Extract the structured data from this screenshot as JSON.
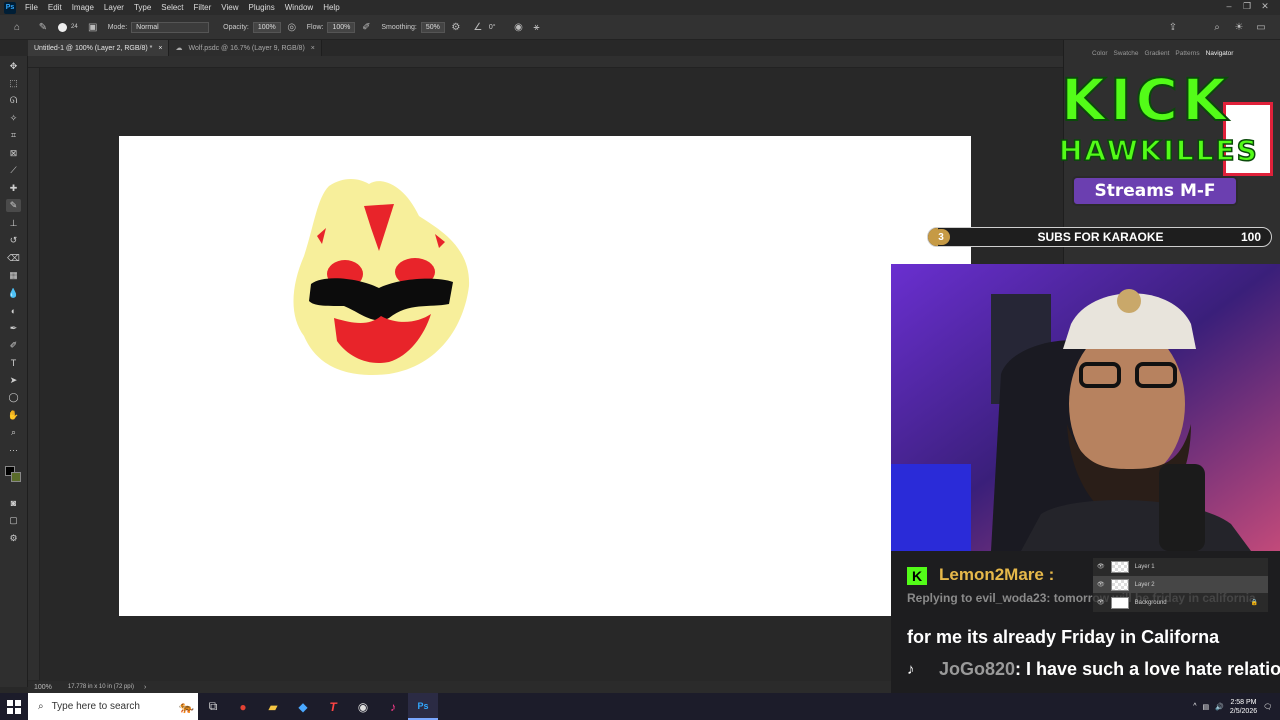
{
  "menubar": {
    "app_logo": "Ps",
    "items": [
      "File",
      "Edit",
      "Image",
      "Layer",
      "Type",
      "Select",
      "Filter",
      "View",
      "Plugins",
      "Window",
      "Help"
    ]
  },
  "options": {
    "brush_size": "24",
    "mode_label": "Mode:",
    "mode_value": "Normal",
    "opacity_label": "Opacity:",
    "opacity_value": "100%",
    "flow_label": "Flow:",
    "flow_value": "100%",
    "smoothing_label": "Smoothing:",
    "smoothing_value": "50%",
    "angle_value": "0°"
  },
  "tabs": [
    {
      "label": "Untitled-1 @ 100% (Layer 2, RGB/8) *"
    },
    {
      "label": "Wolf.psdc @ 16.7% (Layer 9, RGB/8)"
    }
  ],
  "status": {
    "zoom": "100%",
    "doc_size": "17.778 in x 10 in (72 ppi)"
  },
  "right_panel": {
    "tabs": [
      "Color",
      "Swatche",
      "Gradient",
      "Patterns",
      "Navigator"
    ],
    "active_tab": "Navigator"
  },
  "overlay": {
    "logo_line1": "KICK",
    "logo_line2": "HAWKILLES",
    "streams": "Streams M-F",
    "goal_count": "3",
    "goal_title": "SUBS FOR KARAOKE",
    "goal_target": "100",
    "goal_progress": 0.03
  },
  "layers": [
    {
      "name": "Layer 1"
    },
    {
      "name": "Layer 2"
    },
    {
      "name": "Background"
    }
  ],
  "chat": {
    "msg1_user": "Lemon2Mare :",
    "msg1_reply": "Replying to evil_woda23: tomorrow will be friday in california",
    "msg1_text": "for me its already Friday in Californa",
    "msg2_user": "JoGo820",
    "msg2_text": ": I have such a love hate relationship with gozyuger"
  },
  "taskbar": {
    "search_placeholder": "Type here to search",
    "time": "2:58 PM",
    "date": "2/5/2026"
  },
  "colors": {
    "kick_green": "#53fc18",
    "streams_purple": "#6b3fb0",
    "goal_gold": "#c69a45",
    "paint_yellow": "#f7ef9b",
    "paint_red": "#e8242a"
  }
}
